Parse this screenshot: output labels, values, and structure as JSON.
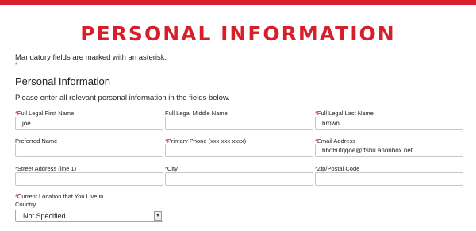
{
  "header": {
    "accent_color": "#d71f2b",
    "title": "PERSONAL INFORMATION"
  },
  "notes": {
    "mandatory": "Mandatory fields are marked with an asterisk.",
    "mandatory_marker": "*"
  },
  "section": {
    "heading": "Personal Information",
    "instructions": "Please enter all relevant personal information in the fields below."
  },
  "fields": {
    "first_name": {
      "label": "Full Legal First Name",
      "required": "*",
      "value": "joe"
    },
    "middle_name": {
      "label": "Full Legal Middle Name",
      "value": ""
    },
    "last_name": {
      "label": "Full Legal Last Name",
      "required": "*",
      "value": "brown"
    },
    "preferred_name": {
      "label": "Preferred Name",
      "value": ""
    },
    "primary_phone": {
      "label": "Primary Phone (xxx-xxx-xxxx)",
      "required": "*",
      "value": ""
    },
    "email": {
      "label": "Email Address",
      "required": "*",
      "value": "bhq6utqqoe@tfshu.anonbox.net"
    },
    "street": {
      "label": "Street Address (line 1)",
      "required": "*",
      "value": ""
    },
    "city": {
      "label": "City",
      "required": "*",
      "value": ""
    },
    "zip": {
      "label": "Zip/Postal Code",
      "required": "*",
      "value": ""
    },
    "location": {
      "label_line1": "Current Location that You Live in",
      "label_line2": "Country",
      "required": "*",
      "selected": "Not Specified",
      "arrow_icon": "chevron-down-icon"
    }
  }
}
